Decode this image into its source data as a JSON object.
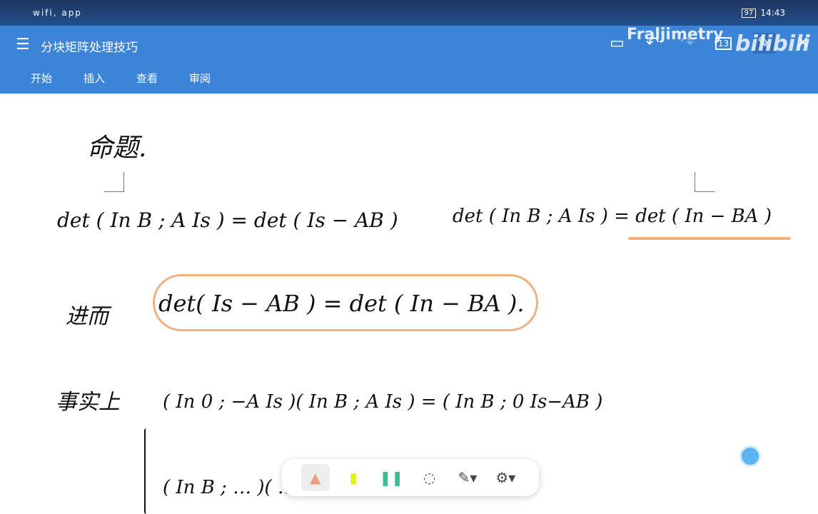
{
  "status": {
    "left_icons": "wifi, app",
    "time": "14:43",
    "battery": "97"
  },
  "app": {
    "title": "分块矩阵处理技巧",
    "tabs": [
      "开始",
      "插入",
      "查看",
      "审阅"
    ],
    "page_count": "13"
  },
  "watermark": {
    "user": "Fraljimetry",
    "brand": "bilibili"
  },
  "note": {
    "heading": "命题.",
    "eq1": "det ( In  B ; A  Is ) = det ( Is − AB )",
    "eq2": "det ( In  B ; A  Is ) = det ( In − BA )",
    "lead2": "进而",
    "eq3": "det( Is − AB ) = det ( In − BA ).",
    "lead3": "事实上",
    "eq4": "( In 0 ; −A Is )( In B ; A Is ) = ( In B ; 0 Is−AB )",
    "eq5": "( In B ; … )( … ) = ( … )"
  },
  "tools": [
    "pen",
    "highlighter",
    "marker",
    "lasso",
    "pencil-options",
    "settings"
  ]
}
